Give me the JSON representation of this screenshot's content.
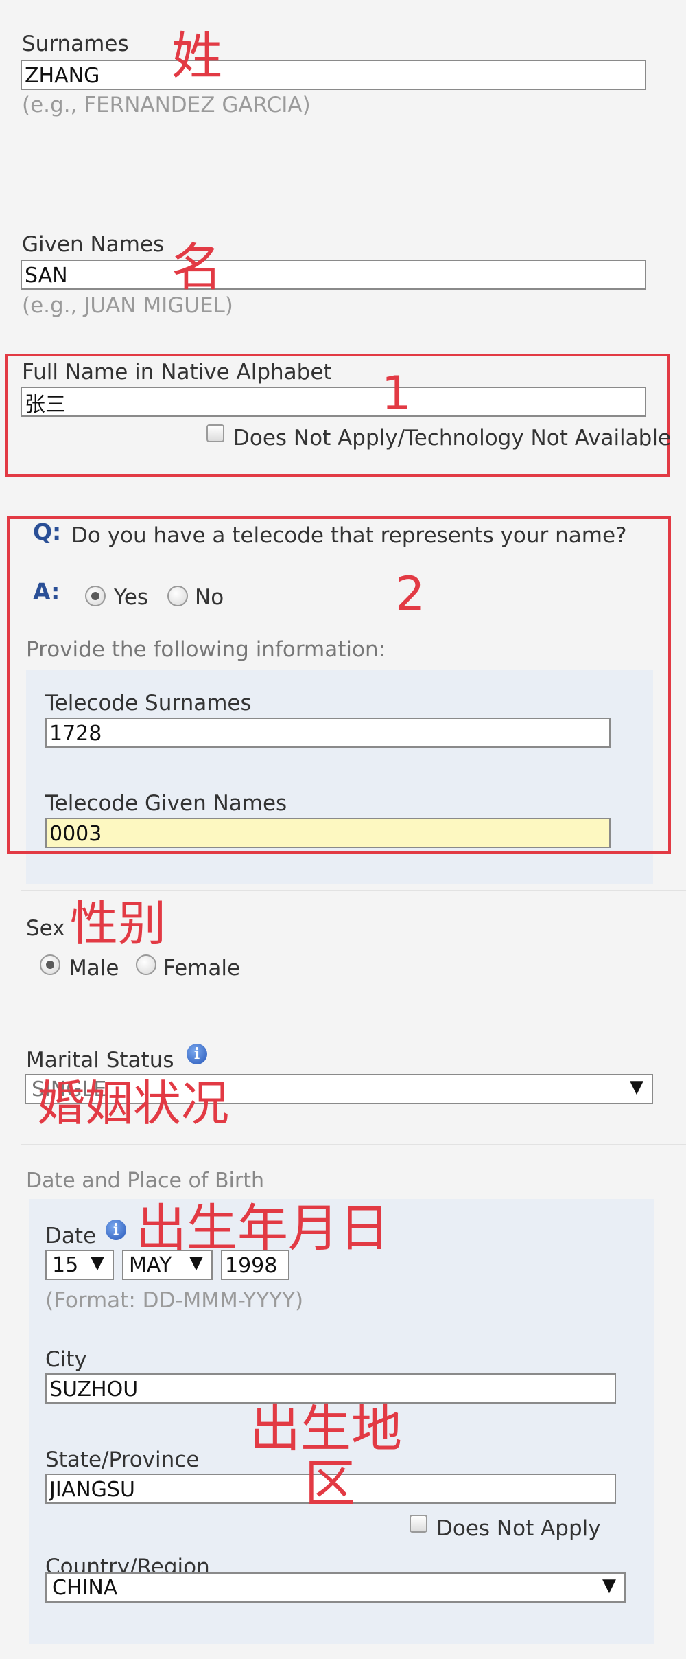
{
  "surnames": {
    "label": "Surnames",
    "value": "ZHANG",
    "hint": "(e.g., FERNANDEZ GARCIA)",
    "annotation": "姓"
  },
  "given_names": {
    "label": "Given Names",
    "value": "SAN",
    "hint": "(e.g., JUAN MIGUEL)",
    "annotation": "名"
  },
  "native_name": {
    "label": "Full Name in Native Alphabet",
    "value": "张三",
    "checkbox_label": "Does Not Apply/Technology Not Available",
    "annotation": "1"
  },
  "telecode": {
    "q_marker": "Q:",
    "question": "Do you have a telecode that represents your name?",
    "a_marker": "A:",
    "yes_label": "Yes",
    "no_label": "No",
    "selected": "Yes",
    "provide_text": "Provide the following information:",
    "surnames_label": "Telecode Surnames",
    "surnames_value": "1728",
    "given_label": "Telecode Given Names",
    "given_value": "0003",
    "annotation": "2"
  },
  "sex": {
    "label": "Sex",
    "male_label": "Male",
    "female_label": "Female",
    "selected": "Male",
    "annotation": "性别"
  },
  "marital": {
    "label": "Marital Status",
    "value": "SINGLE",
    "annotation": "婚姻状况"
  },
  "birth": {
    "section_title": "Date and Place of Birth",
    "date_label": "Date",
    "day": "15",
    "month": "MAY",
    "year": "1998",
    "format_hint": "(Format: DD-MMM-YYYY)",
    "date_annotation": "出生年月日",
    "city_label": "City",
    "city_value": "SUZHOU",
    "state_label": "State/Province",
    "state_value": "JIANGSU",
    "state_checkbox_label": "Does Not Apply",
    "country_label": "Country/Region",
    "country_value": "CHINA",
    "place_annotation_line1": "出生地",
    "place_annotation_line2": "区"
  },
  "icons": {
    "dropdown": "▼",
    "info": "i"
  },
  "colors": {
    "annotation": "#e23a44",
    "panel": "#e9eef5",
    "qa": "#2a4f96",
    "highlight": "#fdf8c1"
  }
}
